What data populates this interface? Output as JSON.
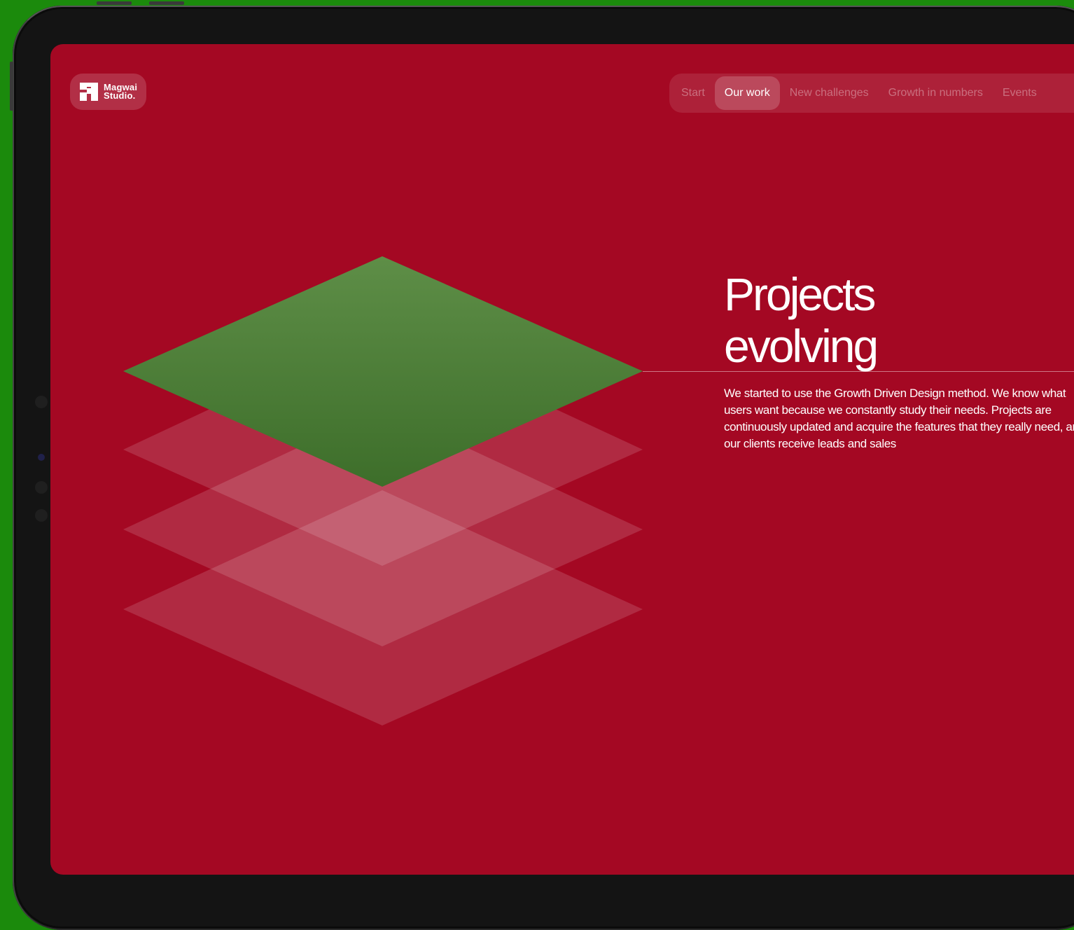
{
  "device": {
    "background_color": "#1b8a0c",
    "screen_color": "#a40823"
  },
  "brand": {
    "logo_icon": "magwai-logo-icon",
    "name": "Magwai\nStudio."
  },
  "nav": {
    "items": [
      {
        "label": "Start",
        "active": false
      },
      {
        "label": "Our work",
        "active": true
      },
      {
        "label": "New challenges",
        "active": false
      },
      {
        "label": "Growth in numbers",
        "active": false
      },
      {
        "label": "Events",
        "active": false
      }
    ]
  },
  "hero": {
    "title_line1": "Projects",
    "title_line2": "evolving",
    "description": "We started to use the Growth Driven Design method. We know what users want because we constantly study their needs. Projects are continuously updated and acquire the features that they really need, and our clients receive leads and sales"
  },
  "illustration": {
    "name": "stacked-layers-illustration",
    "top_layer_color": "#4f8a3c",
    "layer_color": "rgba(255,255,255,0.15)"
  }
}
